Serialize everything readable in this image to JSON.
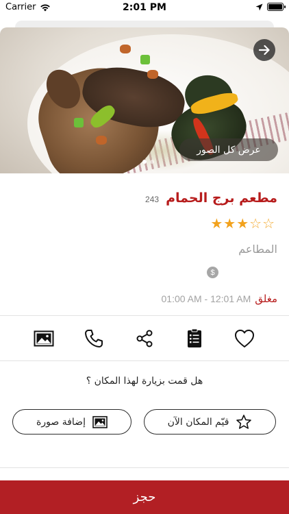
{
  "status_bar": {
    "carrier": "Carrier",
    "time": "2:01 PM"
  },
  "hero": {
    "view_all_label": "عرض كل الصور",
    "page_count": 2,
    "active_page": 1
  },
  "restaurant": {
    "name": "مطعم برج الحمام",
    "review_count": "243",
    "rating": 3,
    "rating_max": 5,
    "category": "المطاعم",
    "price_symbol": "$",
    "status": "مغلق",
    "hours": "01:00 AM - 12:01 AM"
  },
  "actions": [
    {
      "name": "photo-icon"
    },
    {
      "name": "phone-icon"
    },
    {
      "name": "share-icon"
    },
    {
      "name": "menu-icon"
    },
    {
      "name": "heart-icon"
    }
  ],
  "visit": {
    "question": "هل قمت بزيارة لهذا المكان ؟",
    "add_photo_label": "إضافة صورة",
    "rate_label": "قيّم المكان الآن"
  },
  "booking": {
    "label": "حجز"
  },
  "colors": {
    "brand_red": "#b21f24",
    "title_red": "#b71c1c",
    "star": "#f2a21d"
  }
}
